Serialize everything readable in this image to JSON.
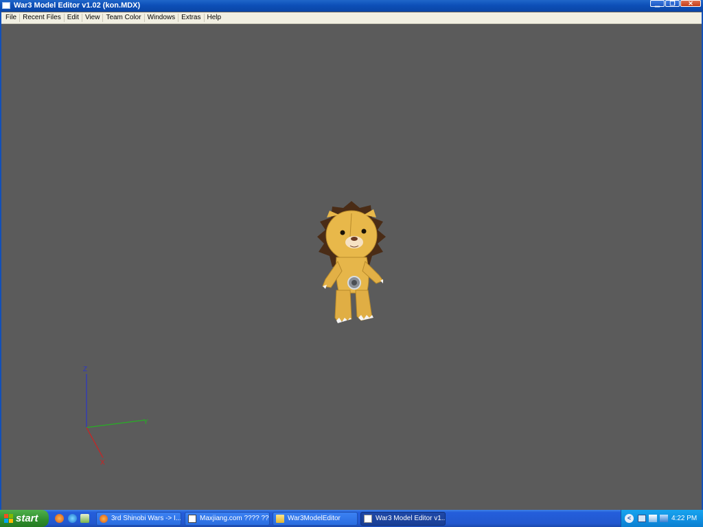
{
  "window": {
    "title": "War3 Model Editor v1.02 (kon.MDX)",
    "controls": {
      "minimize": "▁",
      "maximize": "❐",
      "close": "✕"
    }
  },
  "menu": [
    "File",
    "Recent Files",
    "Edit",
    "View",
    "Team Color",
    "Windows",
    "Extras",
    "Help"
  ],
  "viewport": {
    "background_color": "#5b5b5b",
    "model": "kon",
    "axes": {
      "z_label": "Z",
      "y_label": "Y",
      "x_label": "X",
      "z_color": "#2b36c8",
      "y_color": "#27b024",
      "x_color": "#d02020"
    }
  },
  "taskbar": {
    "start_label": "start",
    "quick_launch": [
      "firefox-icon",
      "media-player-icon",
      "show-desktop-icon"
    ],
    "tasks": [
      {
        "label": "3rd Shinobi Wars -> I...",
        "icon": "firefox-icon",
        "active": false
      },
      {
        "label": "Maxjiang.com ???? ???",
        "icon": "window-icon",
        "active": false
      },
      {
        "label": "War3ModelEditor",
        "icon": "folder-icon",
        "active": false
      },
      {
        "label": "War3 Model Editor v1...",
        "icon": "window-icon",
        "active": true
      }
    ],
    "tray": {
      "clock": "4:22 PM",
      "icons": [
        "network-icon",
        "safely-remove-icon",
        "wireless-icon"
      ]
    }
  }
}
